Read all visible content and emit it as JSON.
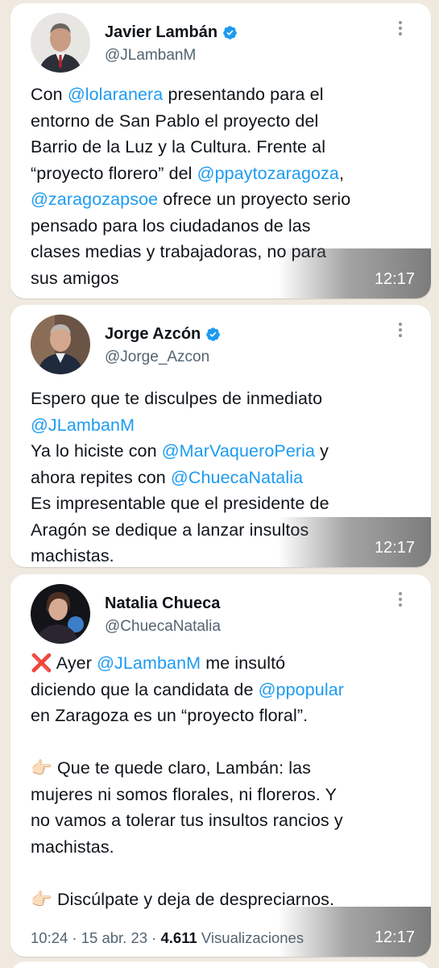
{
  "tweets": [
    {
      "name": "Javier Lambán",
      "handle": "@JLambanM",
      "time": "12:17",
      "lines": {
        "l1a": "Con ",
        "l1m": "@lolaranera",
        "l1b": " presentando para el",
        "l2": "entorno de San Pablo el proyecto del",
        "l3": "Barrio de la Luz y la Cultura. Frente al",
        "l4a": "“proyecto florero” del ",
        "l4m": "@ppaytozaragoza",
        "l4b": ",",
        "l5m": "@zaragozapsoe",
        "l5b": " ofrece un proyecto serio",
        "l6": "pensado para los ciudadanos de las",
        "l7": "clases medias y trabajadoras, no para",
        "l8": "sus amigos"
      }
    },
    {
      "name": "Jorge Azcón",
      "handle": "@Jorge_Azcon",
      "time": "12:17",
      "lines": {
        "l1": "Espero que te disculpes de inmediato",
        "l2m": "@JLambanM",
        "l3a": "Ya lo hiciste con ",
        "l3m": "@MarVaqueroPeria",
        "l3b": " y",
        "l4a": "ahora repites con ",
        "l4m": "@ChuecaNatalia",
        "l5": "Es impresentable que el presidente de",
        "l6": "Aragón se dedique a lanzar insultos",
        "l7": "machistas."
      }
    },
    {
      "name": "Natalia Chueca",
      "handle": "@ChuecaNatalia",
      "time": "12:17",
      "lines": {
        "l1e": "❌",
        "l1a": " Ayer ",
        "l1m": "@JLambanM",
        "l1b": " me insultó",
        "l2a": "diciendo que la candidata de ",
        "l2m": "@ppopular",
        "l3": "en Zaragoza es un “proyecto floral”.",
        "l5e": "👉🏻",
        "l5": " Que te quede claro, Lambán: las",
        "l6": "mujeres ni somos florales, ni floreros. Y",
        "l7": "no vamos a tolerar tus insultos rancios y",
        "l8": "machistas.",
        "l10e": "👉🏻",
        "l10": " Discúlpate y deja de despreciarnos."
      },
      "meta": {
        "clock": "10:24",
        "sep1": " · ",
        "date": "15 abr. 23",
        "sep2": " · ",
        "views_count": "4.611",
        "views_label": " Visualizaciones"
      }
    }
  ],
  "colors": {
    "mention": "#1d9bf0",
    "verified": "#1d9bf0",
    "background": "#efe9e0"
  },
  "icons": {
    "verified": "verified-badge-icon",
    "more": "more-vertical-icon"
  }
}
